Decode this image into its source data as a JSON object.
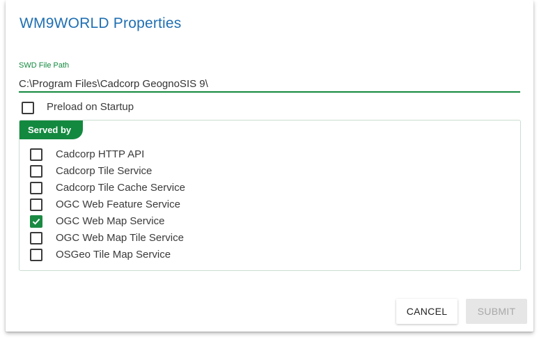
{
  "dialog": {
    "title": "WM9WORLD Properties",
    "swd_label": "SWD File Path",
    "swd_value": "C:\\Program Files\\Cadcorp GeognoSIS 9\\",
    "preload_label": "Preload on Startup",
    "preload_checked": false,
    "served_by_label": "Served by",
    "services": [
      {
        "label": "Cadcorp HTTP API",
        "checked": false
      },
      {
        "label": "Cadcorp Tile Service",
        "checked": false
      },
      {
        "label": "Cadcorp Tile Cache Service",
        "checked": false
      },
      {
        "label": "OGC Web Feature Service",
        "checked": false
      },
      {
        "label": "OGC Web Map Service",
        "checked": true
      },
      {
        "label": "OGC Web Map Tile Service",
        "checked": false
      },
      {
        "label": "OSGeo Tile Map Service",
        "checked": false
      }
    ],
    "cancel_label": "CANCEL",
    "submit_label": "SUBMIT"
  },
  "colors": {
    "title": "#1f6fb2",
    "accent_green": "#13893f",
    "checkbox_checked": "#1b8a43"
  }
}
